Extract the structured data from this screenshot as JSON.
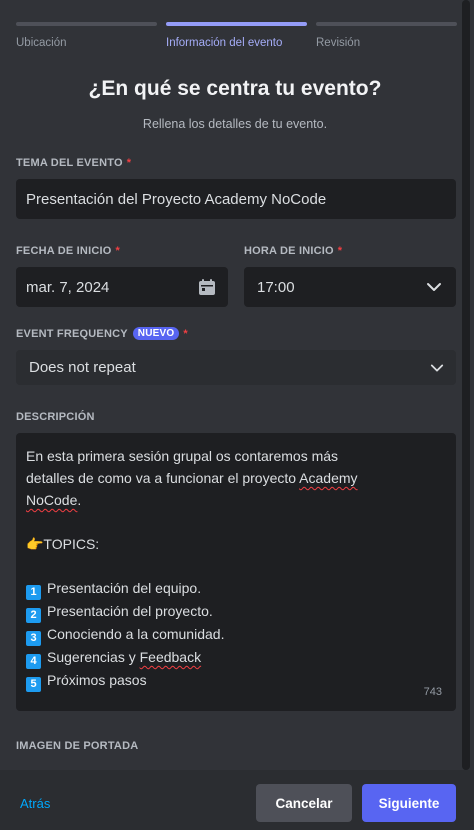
{
  "steps": [
    {
      "label": "Ubicación"
    },
    {
      "label": "Información del evento"
    },
    {
      "label": "Revisión"
    }
  ],
  "title": "¿En qué se centra tu evento?",
  "subtitle": "Rellena los detalles de tu evento.",
  "topic": {
    "label": "TEMA DEL EVENTO",
    "required": "*",
    "value": "Presentación del Proyecto Academy NoCode"
  },
  "start_date": {
    "label": "FECHA DE INICIO",
    "required": "*",
    "value": "mar. 7, 2024"
  },
  "start_time": {
    "label": "HORA DE INICIO",
    "required": "*",
    "value": "17:00"
  },
  "frequency": {
    "label": "EVENT FREQUENCY",
    "badge": "NUEVO",
    "required": "*",
    "value": "Does not repeat"
  },
  "description": {
    "label": "DESCRIPCIÓN",
    "line1": "En esta primera sesión grupal os contaremos más",
    "line2_pre": "detalles de como va a funcionar el proyecto ",
    "line2_word": "Academy",
    "line3_word": "NoCode",
    "line3_post": ".",
    "topics": "👉TOPICS:",
    "items": [
      {
        "num": "1",
        "text": "Presentación del equipo."
      },
      {
        "num": "2",
        "text": "Presentación del proyecto."
      },
      {
        "num": "3",
        "text": "Conociendo a la comunidad."
      },
      {
        "num": "4",
        "text_pre": "Sugerencias y ",
        "text_word": "Feedback"
      },
      {
        "num": "5",
        "text": "Próximos pasos"
      }
    ],
    "counter": "743"
  },
  "cover_image": {
    "label": "IMAGEN DE PORTADA"
  },
  "footer": {
    "back": "Atrás",
    "cancel": "Cancelar",
    "next": "Siguiente"
  },
  "colors": {
    "accent": "#5865f2",
    "active_step": "#949cf7",
    "link": "#00a8fc",
    "required": "#f23f43"
  }
}
